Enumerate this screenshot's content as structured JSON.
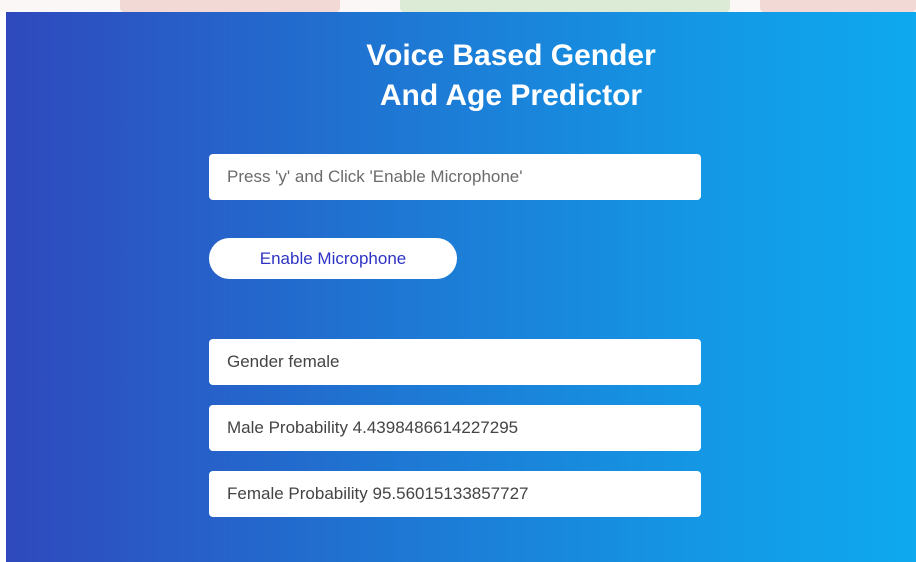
{
  "header": {
    "title_line1": "Voice Based Gender",
    "title_line2": "And Age Predictor"
  },
  "input": {
    "placeholder": "Press 'y' and Click 'Enable Microphone'"
  },
  "buttons": {
    "enable_microphone": "Enable Microphone"
  },
  "results": {
    "gender": "Gender  female",
    "male_probability": "Male Probability 4.4398486614227295",
    "female_probability": "Female Probability 95.56015133857727"
  }
}
